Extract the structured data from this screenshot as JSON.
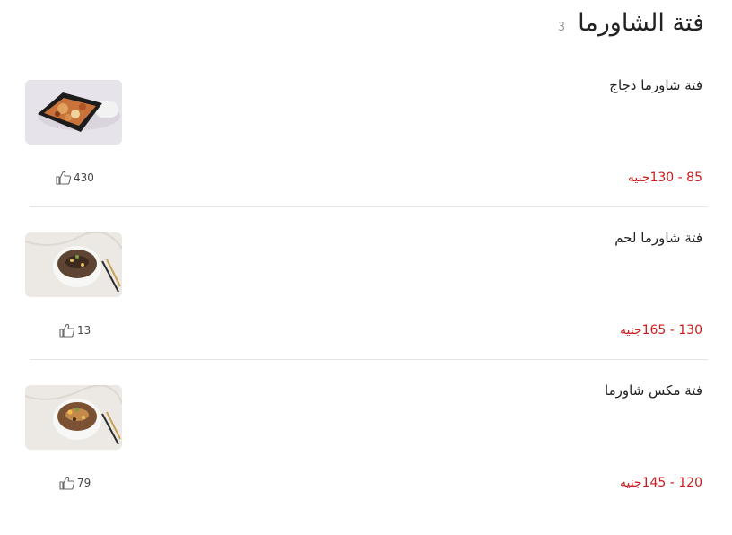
{
  "section": {
    "title": "فتة الشاورما",
    "count": "3"
  },
  "items": [
    {
      "name": "فتة شاورما دجاج",
      "price": "85 - 130جنيه",
      "likes": "430",
      "image": "chicken-shawarma-fatteh-photo"
    },
    {
      "name": "فتة شاورما لحم",
      "price": "130 - 165جنيه",
      "likes": "13",
      "image": "beef-shawarma-fatteh-photo"
    },
    {
      "name": "فتة مكس شاورما",
      "price": "120 - 145جنيه",
      "likes": "79",
      "image": "mix-shawarma-fatteh-photo"
    }
  ],
  "colors": {
    "price": "#cc1b1b",
    "count": "#9a9a9a",
    "divider": "#e4e4e4"
  }
}
